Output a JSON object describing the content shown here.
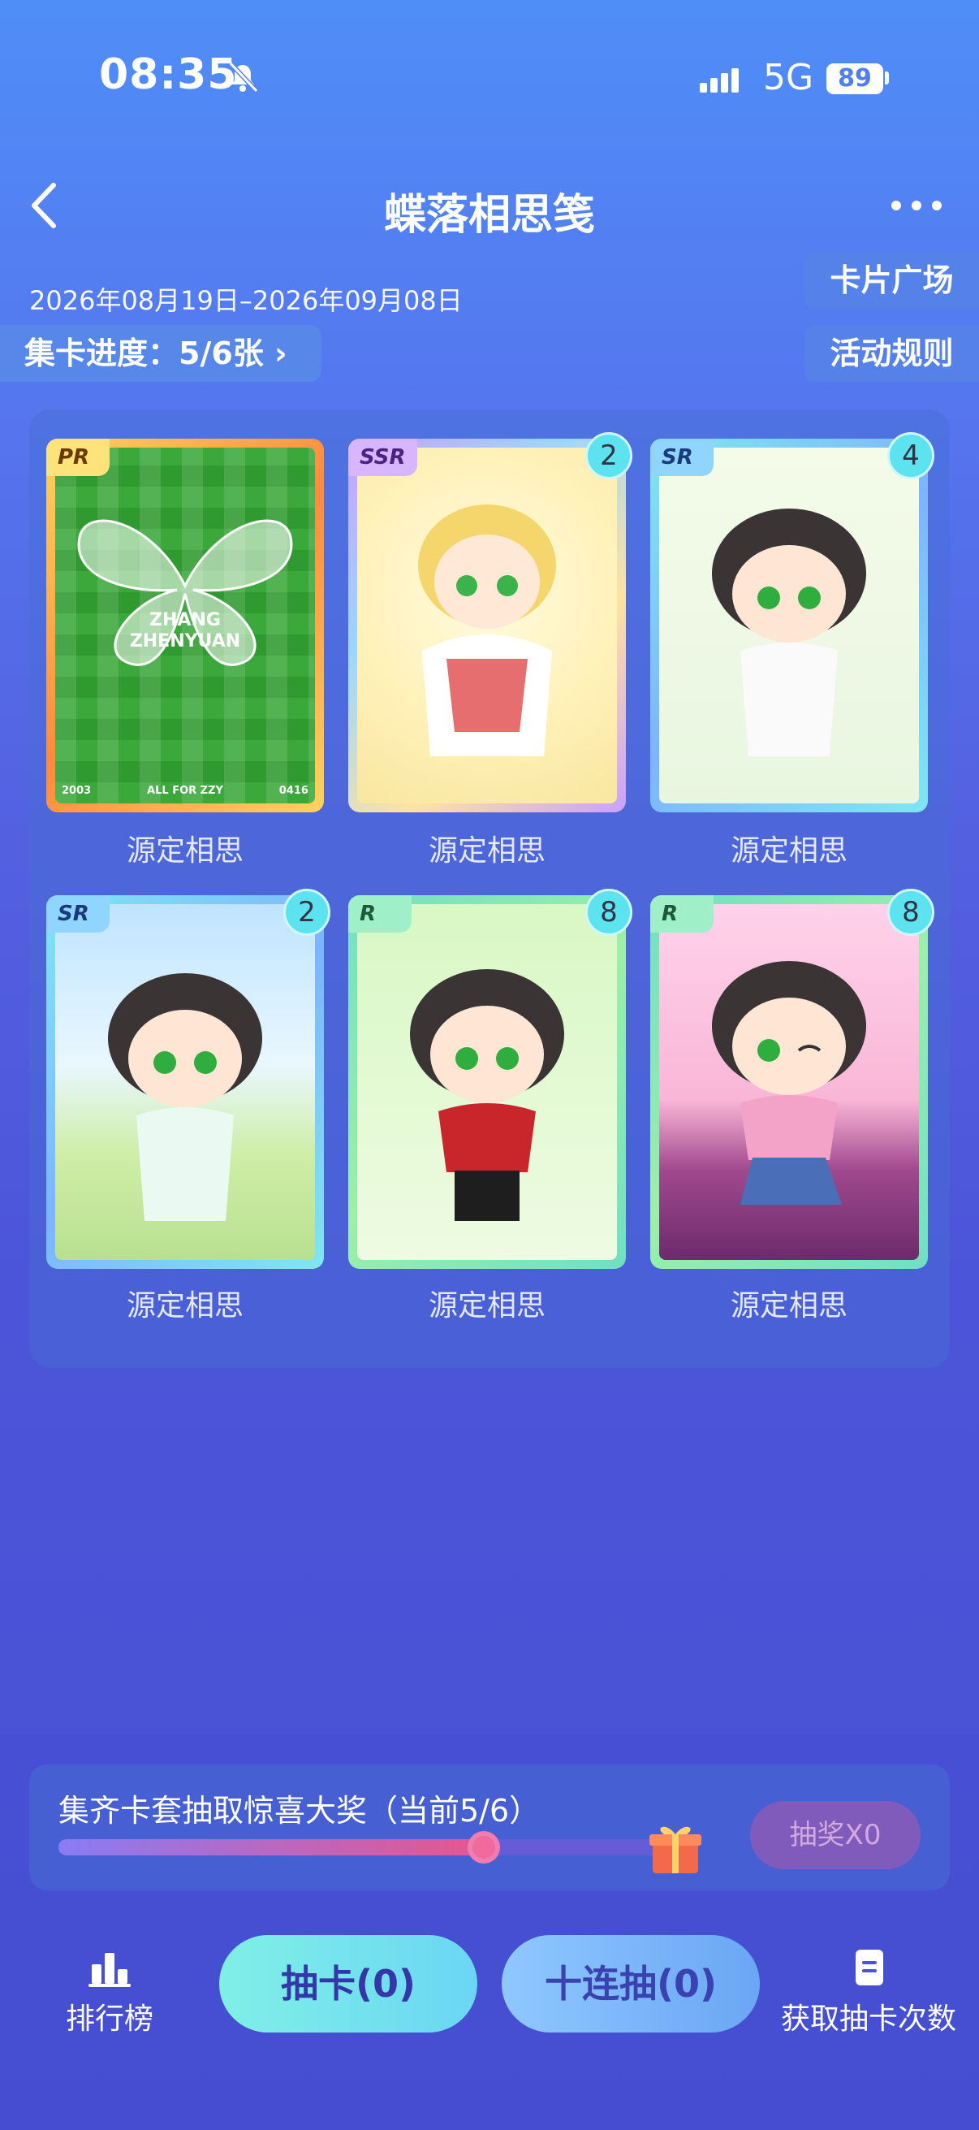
{
  "status_bar": {
    "time": "08:35",
    "network": "5G",
    "battery": "89"
  },
  "header": {
    "title": "蝶落相思笺",
    "date_range": "2026年08月19日–2026年09月08日"
  },
  "side_buttons": {
    "card_plaza": "卡片广场",
    "event_rules": "活动规则"
  },
  "progress": {
    "label": "集卡进度：5/6张 ›"
  },
  "cards": [
    {
      "rarity": "PR",
      "count": "",
      "name": "源定相思",
      "art_text_1": "ZHANG",
      "art_text_2": "ZHENYUAN",
      "foot_left": "2003",
      "foot_mid": "ALL FOR ZZY",
      "foot_right": "0416"
    },
    {
      "rarity": "SSR",
      "count": "2",
      "name": "源定相思"
    },
    {
      "rarity": "SR",
      "count": "4",
      "name": "源定相思"
    },
    {
      "rarity": "SR",
      "count": "2",
      "name": "源定相思"
    },
    {
      "rarity": "R",
      "count": "8",
      "name": "源定相思"
    },
    {
      "rarity": "R",
      "count": "8",
      "name": "源定相思"
    }
  ],
  "prize": {
    "text": "集齐卡套抽取惊喜大奖（当前5/6）",
    "progress_fraction": 0.8333,
    "lottery_button": "抽奖X0"
  },
  "bottom_nav": {
    "ranking": "排行榜",
    "draw": "抽卡(0)",
    "draw_ten": "十连抽(0)",
    "get_draws": "获取抽卡次数"
  },
  "colors": {
    "accent_cyan": "#7ff0e6",
    "badge": "#5de3f0",
    "progress_pink": "#e6558f"
  }
}
